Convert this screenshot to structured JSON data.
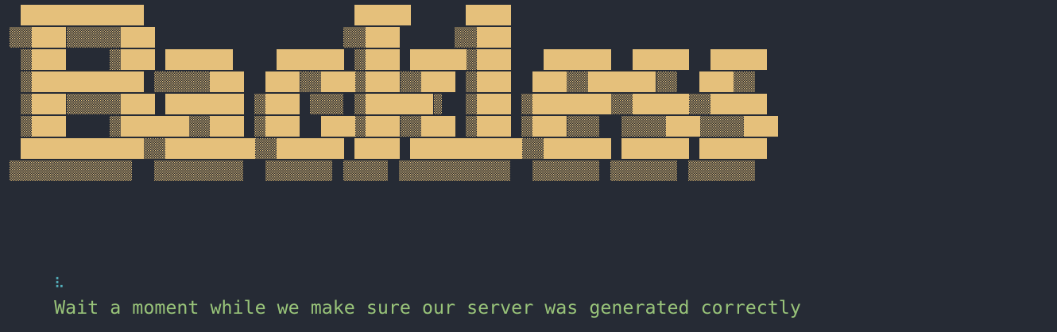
{
  "banner": {
    "text": "Backless",
    "fill_color": "#e5c07b",
    "shade_color": "#e5c07b",
    "background": "#262b35"
  },
  "status": {
    "spinner": "⠧",
    "message": "Wait a moment while we make sure our server was generated correctly",
    "spinner_color": "#56b6c2",
    "message_color": "#98c379"
  }
}
